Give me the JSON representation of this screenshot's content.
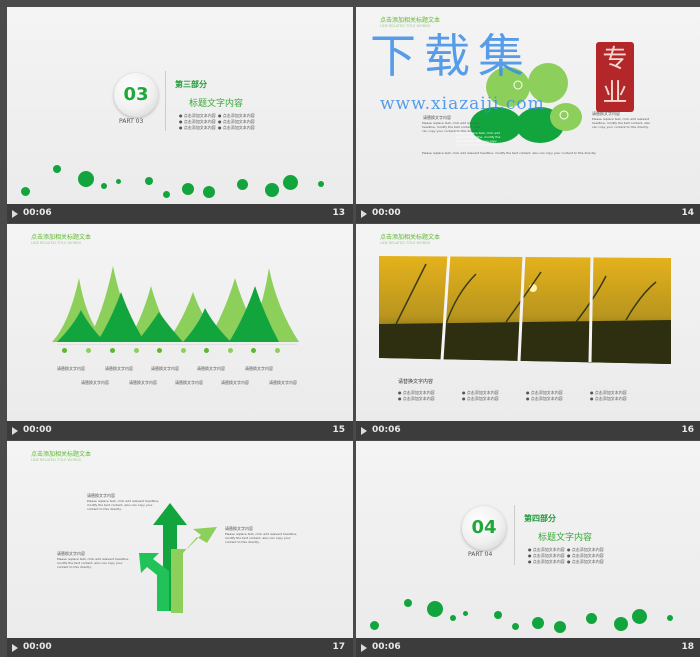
{
  "slides": [
    {
      "time": "00:06",
      "num": "13",
      "part_num": "03",
      "part_label": "PART 03",
      "part_name": "第三部分",
      "title": "标题文字内容",
      "bullets": [
        "● 点击添加文本内容",
        "● 点击添加文本内容",
        "● 点击添加文本内容",
        "● 点击添加文本内容",
        "● 点击添加文本内容",
        "● 点击添加文本内容"
      ]
    },
    {
      "time": "00:00",
      "num": "14",
      "header": "点击添加相关标题文本",
      "header_sub": "LIDE RELATED TITLE WORDS",
      "para": "Please replace text, click add relevant headline, modify the text content, also can copy your content to this directly.",
      "label": "请替换文字内容"
    },
    {
      "time": "00:00",
      "num": "15",
      "header": "点击添加相关标题文本",
      "header_sub": "LIDE RELATED TITLE WORDS",
      "labels": [
        "请替换文字内容",
        "请替换文字内容",
        "请替换文字内容",
        "请替换文字内容",
        "请替换文字内容",
        "请替换文字内容",
        "请替换文字内容",
        "请替换文字内容",
        "请替换文字内容",
        "请替换文字内容"
      ]
    },
    {
      "time": "00:06",
      "num": "16",
      "header": "点击添加相关标题文本",
      "header_sub": "LIDE RELATED TITLE WORDS",
      "caption": "请替换文字内容",
      "bullets": [
        "● 点击添加文本内容",
        "● 点击添加文本内容",
        "● 点击添加文本内容",
        "● 点击添加文本内容",
        "● 点击添加文本内容",
        "● 点击添加文本内容",
        "● 点击添加文本内容",
        "● 点击添加文本内容"
      ]
    },
    {
      "time": "00:00",
      "num": "17",
      "header": "点击添加相关标题文本",
      "header_sub": "LIDE RELATED TITLE WORDS",
      "label_a": "请替换文字内容",
      "label_b": "请替换文字内容",
      "label_c": "请替换文字内容",
      "para": "Please replace text, click add relevant headline, modify the text content, also can copy your content to this directly."
    },
    {
      "time": "00:06",
      "num": "18",
      "part_num": "04",
      "part_label": "PART 04",
      "part_name": "第四部分",
      "title": "标题文字内容",
      "bullets": [
        "● 点击添加文本内容",
        "● 点击添加文本内容",
        "● 点击添加文本内容",
        "● 点击添加文本内容",
        "● 点击添加文本内容",
        "● 点击添加文本内容"
      ]
    }
  ],
  "watermark": {
    "big": "下载集",
    "url": "www.xiazaiji.com",
    "seal": "专业"
  },
  "colors": {
    "green": "#12a53d",
    "light_green": "#8ccf5a",
    "bar": "#3c3c3c"
  }
}
